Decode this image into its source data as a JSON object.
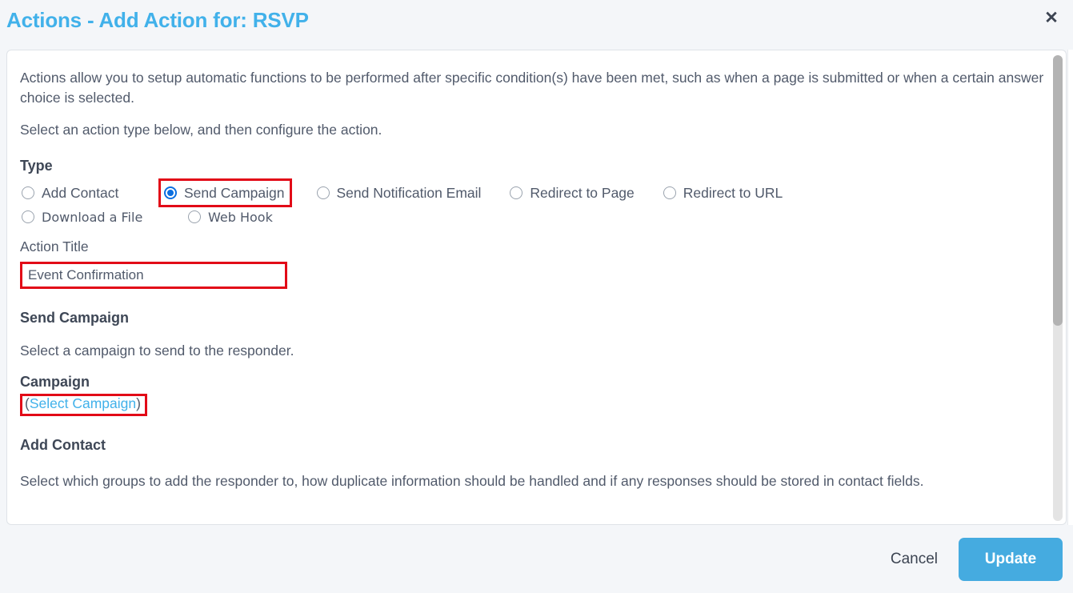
{
  "header": {
    "title": "Actions - Add Action for: RSVP",
    "close_icon": "close-icon",
    "close_glyph": "✕",
    "title_color": "#41b1ea"
  },
  "body": {
    "intro_paragraph": "Actions allow you to setup automatic functions to be performed after specific condition(s) have been met, such as when a page is submitted or when a certain answer choice is selected.",
    "instruction_paragraph": "Select an action type below, and then configure the action.",
    "type_section": {
      "heading": "Type",
      "options": [
        {
          "label": "Add Contact",
          "checked": false,
          "highlighted": false
        },
        {
          "label": "Send Campaign",
          "checked": true,
          "highlighted": true
        },
        {
          "label": "Send Notification Email",
          "checked": false,
          "highlighted": false
        },
        {
          "label": "Redirect to Page",
          "checked": false,
          "highlighted": false
        },
        {
          "label": "Redirect to URL",
          "checked": false,
          "highlighted": false
        },
        {
          "label": "Download a File",
          "checked": false,
          "highlighted": false
        },
        {
          "label": "Web Hook",
          "checked": false,
          "highlighted": false
        }
      ]
    },
    "action_title": {
      "label": "Action Title",
      "value": "Event Confirmation",
      "placeholder": "",
      "highlighted": true
    },
    "send_campaign_section": {
      "heading": "Send Campaign",
      "description": "Select a campaign to send to the responder.",
      "campaign_label": "Campaign",
      "open_paren": "(",
      "select_campaign_link": "Select Campaign",
      "close_paren": ")",
      "highlighted": true
    },
    "add_contact_section": {
      "heading": "Add Contact",
      "description": "Select which groups to add the responder to, how duplicate information should be handled and if any responses should be stored in contact fields."
    }
  },
  "footer": {
    "cancel_label": "Cancel",
    "update_label": "Update",
    "update_color": "#45abe0"
  },
  "annotation": {
    "highlight_color": "#e20a17"
  }
}
